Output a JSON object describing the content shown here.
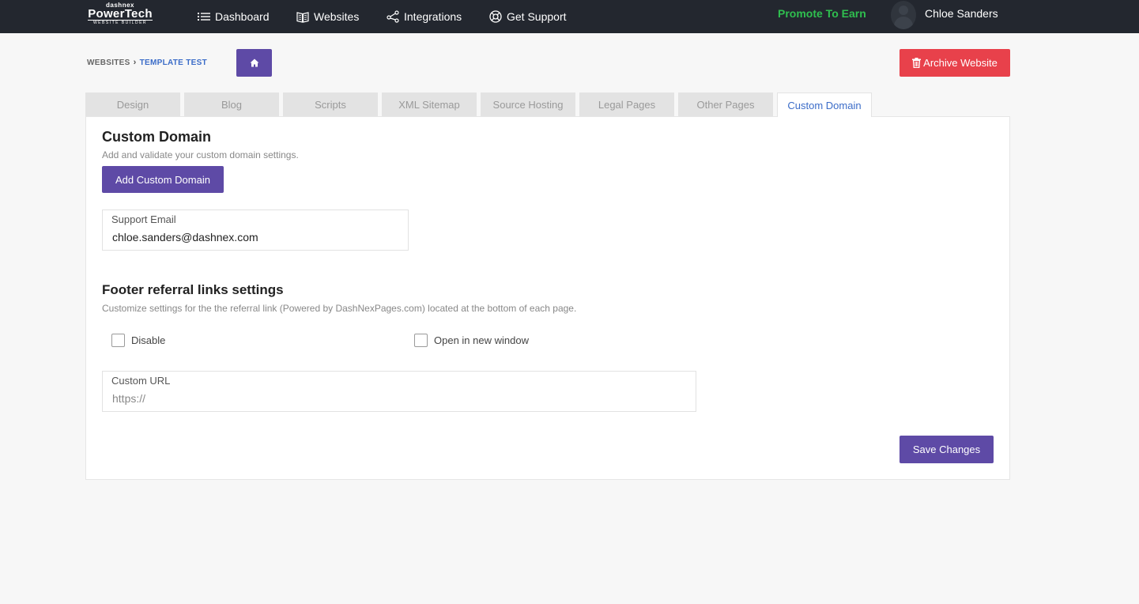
{
  "brand": {
    "line1": "dashnex",
    "line2": "PowerTech",
    "line3": "WEBSITE BUILDER"
  },
  "nav": {
    "items": [
      {
        "label": "Dashboard",
        "icon": "list-icon"
      },
      {
        "label": "Websites",
        "icon": "book-icon"
      },
      {
        "label": "Integrations",
        "icon": "share-icon"
      },
      {
        "label": "Get Support",
        "icon": "lifebuoy-icon"
      }
    ],
    "promote": "Promote To Earn",
    "user_name": "Chloe Sanders"
  },
  "breadcrumb": {
    "root": "WEBSITES",
    "separator": "›",
    "current": "TEMPLATE TEST"
  },
  "archive_label": "Archive Website",
  "tabs": [
    {
      "label": "Design"
    },
    {
      "label": "Blog"
    },
    {
      "label": "Scripts"
    },
    {
      "label": "XML Sitemap"
    },
    {
      "label": "Source Hosting"
    },
    {
      "label": "Legal Pages"
    },
    {
      "label": "Other Pages"
    },
    {
      "label": "Custom Domain",
      "active": true
    }
  ],
  "custom_domain": {
    "title": "Custom Domain",
    "subtitle": "Add and validate your custom domain settings.",
    "add_button": "Add Custom Domain",
    "support_email_label": "Support Email",
    "support_email_value": "chloe.sanders@dashnex.com"
  },
  "footer": {
    "title": "Footer referral links settings",
    "subtitle": "Customize settings for the the referral link (Powered by DashNexPages.com) located at the bottom of each page.",
    "disable_label": "Disable",
    "disable_checked": false,
    "new_window_label": "Open in new window",
    "new_window_checked": false,
    "custom_url_label": "Custom URL",
    "custom_url_value": "",
    "custom_url_placeholder": "https://"
  },
  "save_label": "Save Changes",
  "colors": {
    "navbar": "#23272f",
    "primary": "#5e4aa6",
    "danger": "#e8414b",
    "promote": "#2fbf4f",
    "link": "#3b6cc8"
  }
}
